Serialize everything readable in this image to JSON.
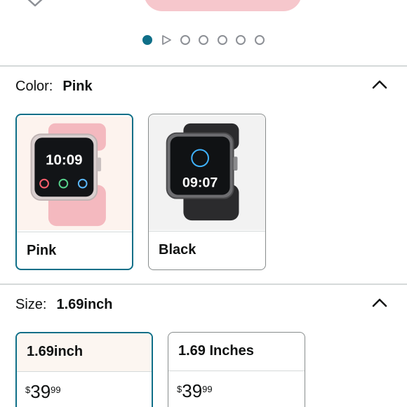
{
  "carousel": {
    "total_dots": 7,
    "active_index": 0,
    "video_index": 1,
    "active_color": "#0f6f88",
    "inactive_color": "#8d9096"
  },
  "color_section": {
    "label": "Color:",
    "selected": "Pink",
    "swatches": [
      {
        "label": "Pink",
        "selected": true,
        "screen_time": "10:09"
      },
      {
        "label": "Black",
        "selected": false,
        "screen_time": "09:07"
      }
    ]
  },
  "size_section": {
    "label": "Size:",
    "selected": "1.69inch",
    "options": [
      {
        "label": "1.69inch",
        "selected": true,
        "price_symbol": "$",
        "price_whole": "39",
        "price_fraction": "99"
      },
      {
        "label": "1.69 Inches",
        "selected": false,
        "price_symbol": "$",
        "price_whole": "39",
        "price_fraction": "99"
      }
    ]
  },
  "colors": {
    "accent": "#0f6f88",
    "pink_band": "#f6c7cc",
    "divider": "#d5d9d9"
  },
  "icons": [
    "chevron-down-icon",
    "chevron-up-icon",
    "play-icon"
  ]
}
